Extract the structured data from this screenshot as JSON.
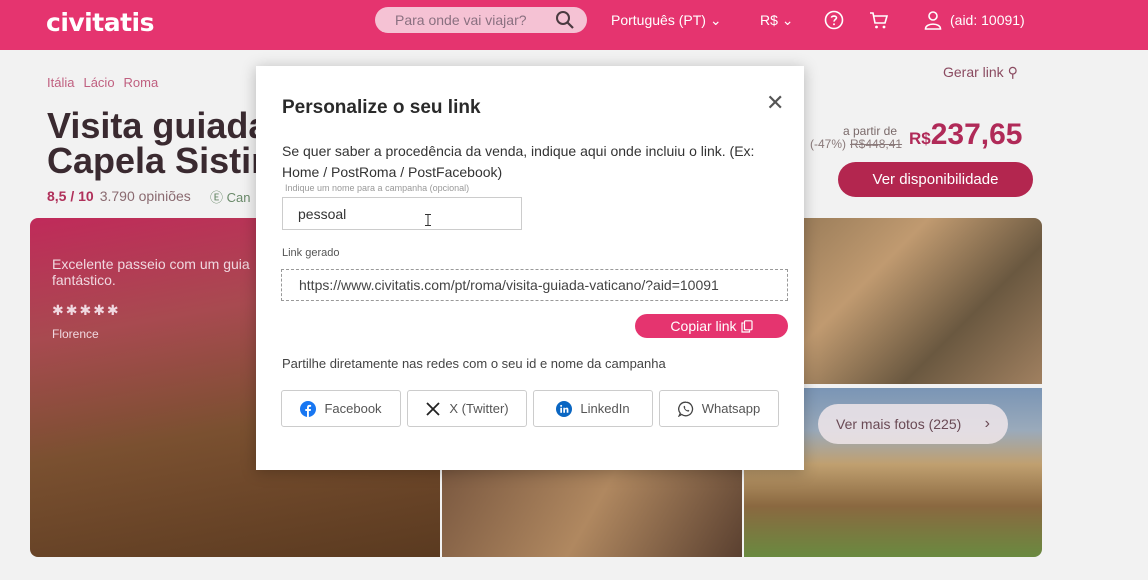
{
  "header": {
    "logo": "civitatis",
    "search_placeholder": "Para onde vai viajar?",
    "language": "Português (PT) ⌄",
    "currency": "R$ ⌄",
    "user_label": "(aid: 10091)"
  },
  "page": {
    "breadcrumb": [
      "Itália",
      "Lácio",
      "Roma"
    ],
    "title_line1": "Visita guiada",
    "title_line2": "Capela Sistin",
    "rating_score": "8,5 / 10",
    "rating_count": "3.790 opiniões",
    "cancel_text": "Can",
    "gerar_link": "Gerar link",
    "price_from": "a partir de",
    "discount": "(-47%)",
    "old_price": "R$448,41",
    "price_currency": "R$",
    "price_value": "237,65",
    "availability_button": "Ver disponibilidade",
    "review_text": "Excelente passeio com um guia fantástico.",
    "review_stars": "✱✱✱✱✱",
    "reviewer": "Florence",
    "more_photos": "Ver mais fotos (225)"
  },
  "modal": {
    "title": "Personalize o seu link",
    "description": "Se quer saber a procedência da venda, indique aqui onde incluiu o link. (Ex: Home / PostRoma / PostFacebook)",
    "campaign_label": "Indique um nome para a campanha (opcional)",
    "campaign_value": "pessoal",
    "generated_label": "Link gerado",
    "generated_link": "https://www.civitatis.com/pt/roma/visita-guiada-vaticano/?aid=10091",
    "copy_button": "Copiar link",
    "share_text": "Partilhe diretamente nas redes com o seu id e nome da campanha",
    "social": [
      {
        "label": "Facebook",
        "icon": "facebook-icon"
      },
      {
        "label": "X (Twitter)",
        "icon": "x-icon"
      },
      {
        "label": "LinkedIn",
        "icon": "linkedin-icon"
      },
      {
        "label": "Whatsapp",
        "icon": "whatsapp-icon"
      }
    ]
  },
  "colors": {
    "brand": "#e5346f",
    "brand_dark": "#b3264f"
  }
}
